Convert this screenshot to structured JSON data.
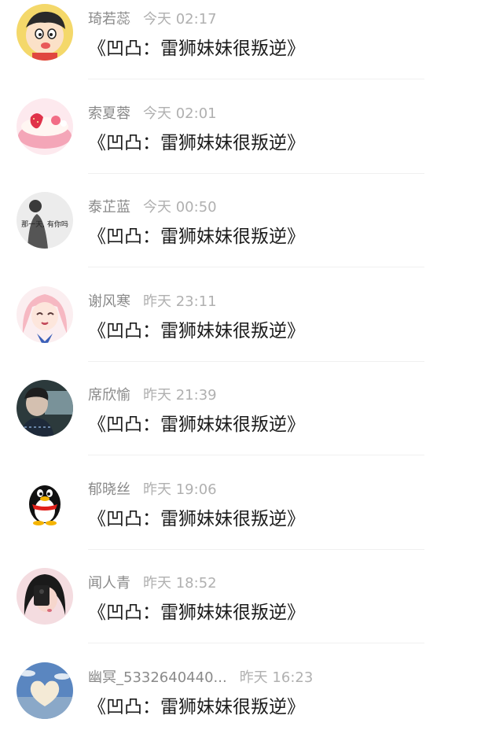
{
  "comments": [
    {
      "user": "琦若蕊",
      "time": "今天 02:17",
      "text": "《凹凸：雷狮妹妹很叛逆》",
      "avatar": "cartoon-boy-avatar"
    },
    {
      "user": "索夏蓉",
      "time": "今天 02:01",
      "text": "《凹凸：雷狮妹妹很叛逆》",
      "avatar": "strawberry-cake-avatar"
    },
    {
      "user": "泰芷蓝",
      "time": "今天 00:50",
      "text": "《凹凸：雷狮妹妹很叛逆》",
      "avatar": "girl-text-avatar",
      "avatar_text": "那一天, 有你吗"
    },
    {
      "user": "谢风寒",
      "time": "昨天 23:11",
      "text": "《凹凸：雷狮妹妹很叛逆》",
      "avatar": "anime-girl-avatar"
    },
    {
      "user": "席欣愉",
      "time": "昨天 21:39",
      "text": "《凹凸：雷狮妹妹很叛逆》",
      "avatar": "boy-photo-avatar"
    },
    {
      "user": "郁晓丝",
      "time": "昨天 19:06",
      "text": "《凹凸：雷狮妹妹很叛逆》",
      "avatar": "qq-penguin-avatar"
    },
    {
      "user": "闻人青",
      "time": "昨天 18:52",
      "text": "《凹凸：雷狮妹妹很叛逆》",
      "avatar": "girl-selfie-avatar"
    },
    {
      "user": "幽冥_5332640440...",
      "time": "昨天 16:23",
      "text": "《凹凸：雷狮妹妹很叛逆》",
      "avatar": "heart-cloud-avatar"
    }
  ]
}
